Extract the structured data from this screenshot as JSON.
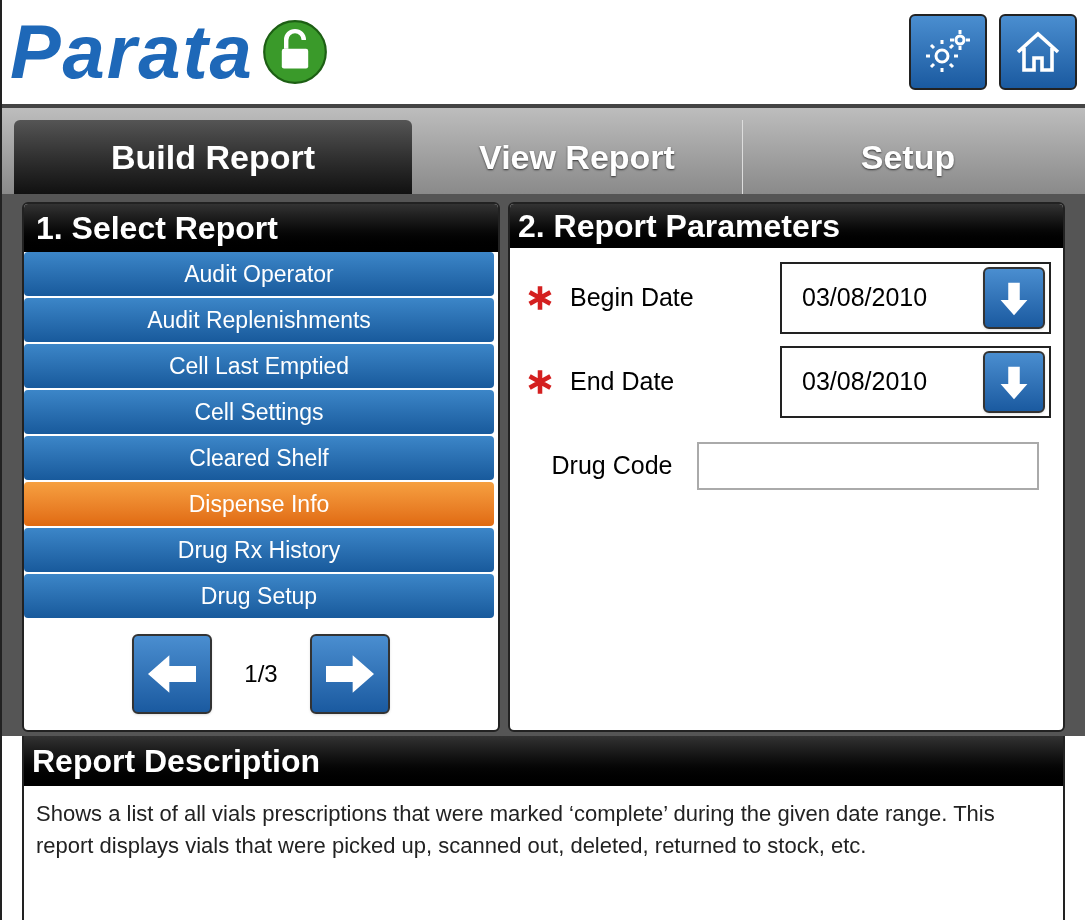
{
  "header": {
    "logo": "Parata",
    "lock": {
      "open": true
    }
  },
  "tabs": [
    {
      "label": "Build Report",
      "selected": true
    },
    {
      "label": "View Report",
      "selected": false
    },
    {
      "label": "Setup",
      "selected": false
    }
  ],
  "select_report": {
    "title": "1. Select Report",
    "items": [
      {
        "label": "Audit Operator",
        "selected": false
      },
      {
        "label": "Audit Replenishments",
        "selected": false
      },
      {
        "label": "Cell Last Emptied",
        "selected": false
      },
      {
        "label": "Cell Settings",
        "selected": false
      },
      {
        "label": "Cleared Shelf",
        "selected": false
      },
      {
        "label": "Dispense Info",
        "selected": true
      },
      {
        "label": "Drug Rx History",
        "selected": false
      },
      {
        "label": "Drug Setup",
        "selected": false
      }
    ],
    "page": "1/3"
  },
  "report_parameters": {
    "title": "2. Report Parameters",
    "fields": [
      {
        "kind": "date",
        "label": "Begin Date",
        "required": true,
        "value": "03/08/2010"
      },
      {
        "kind": "date",
        "label": "End Date",
        "required": true,
        "value": "03/08/2010"
      },
      {
        "kind": "text",
        "label": "Drug Code",
        "required": false
      }
    ]
  },
  "report_description": {
    "title": "Report Description",
    "text": "Shows a list of all vials prescriptions that were marked ‘complete’ during the given date range. This report displays vials that were picked up, scanned out, deleted, returned to stock, etc."
  }
}
